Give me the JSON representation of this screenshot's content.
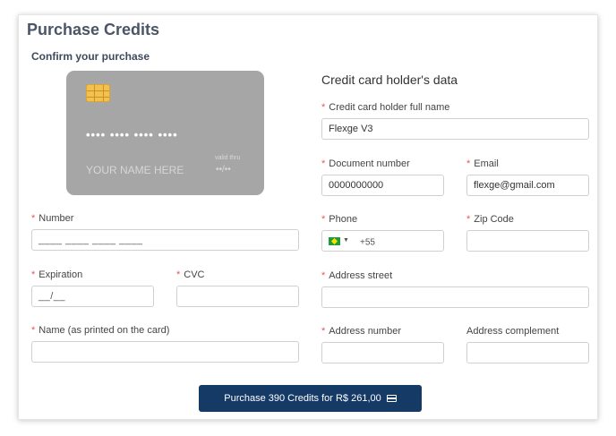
{
  "page": {
    "title": "Purchase Credits",
    "subtitle": "Confirm your purchase"
  },
  "card_preview": {
    "number": "•••• •••• •••• ••••",
    "name": "YOUR NAME HERE",
    "valid_label": "valid thru",
    "valid_value": "••/••"
  },
  "card_form": {
    "number": {
      "label": "Number",
      "placeholder": "____ ____ ____ ____"
    },
    "expiration": {
      "label": "Expiration",
      "placeholder": "__/__"
    },
    "cvc": {
      "label": "CVC",
      "value": ""
    },
    "name": {
      "label": "Name (as printed on the card)",
      "value": ""
    }
  },
  "holder": {
    "title": "Credit card holder's data",
    "full_name": {
      "label": "Credit card holder full name",
      "value": "Flexge V3"
    },
    "document": {
      "label": "Document number",
      "value": "0000000000"
    },
    "email": {
      "label": "Email",
      "value": "flexge@gmail.com"
    },
    "phone": {
      "label": "Phone",
      "dial_code": "+55",
      "flag": "brazil-flag-icon"
    },
    "zip": {
      "label": "Zip Code",
      "value": ""
    },
    "street": {
      "label": "Address street",
      "value": ""
    },
    "address_number": {
      "label": "Address number",
      "value": ""
    },
    "complement": {
      "label": "Address complement",
      "value": ""
    }
  },
  "required_marker": "*",
  "purchase_button": {
    "label": "Purchase 390 Credits for R$ 261,00",
    "icon": "wallet-icon"
  },
  "colors": {
    "button_bg": "#153a66",
    "required": "#e05a5a",
    "card_bg": "#a6a6a6",
    "title": "#4a5568"
  }
}
